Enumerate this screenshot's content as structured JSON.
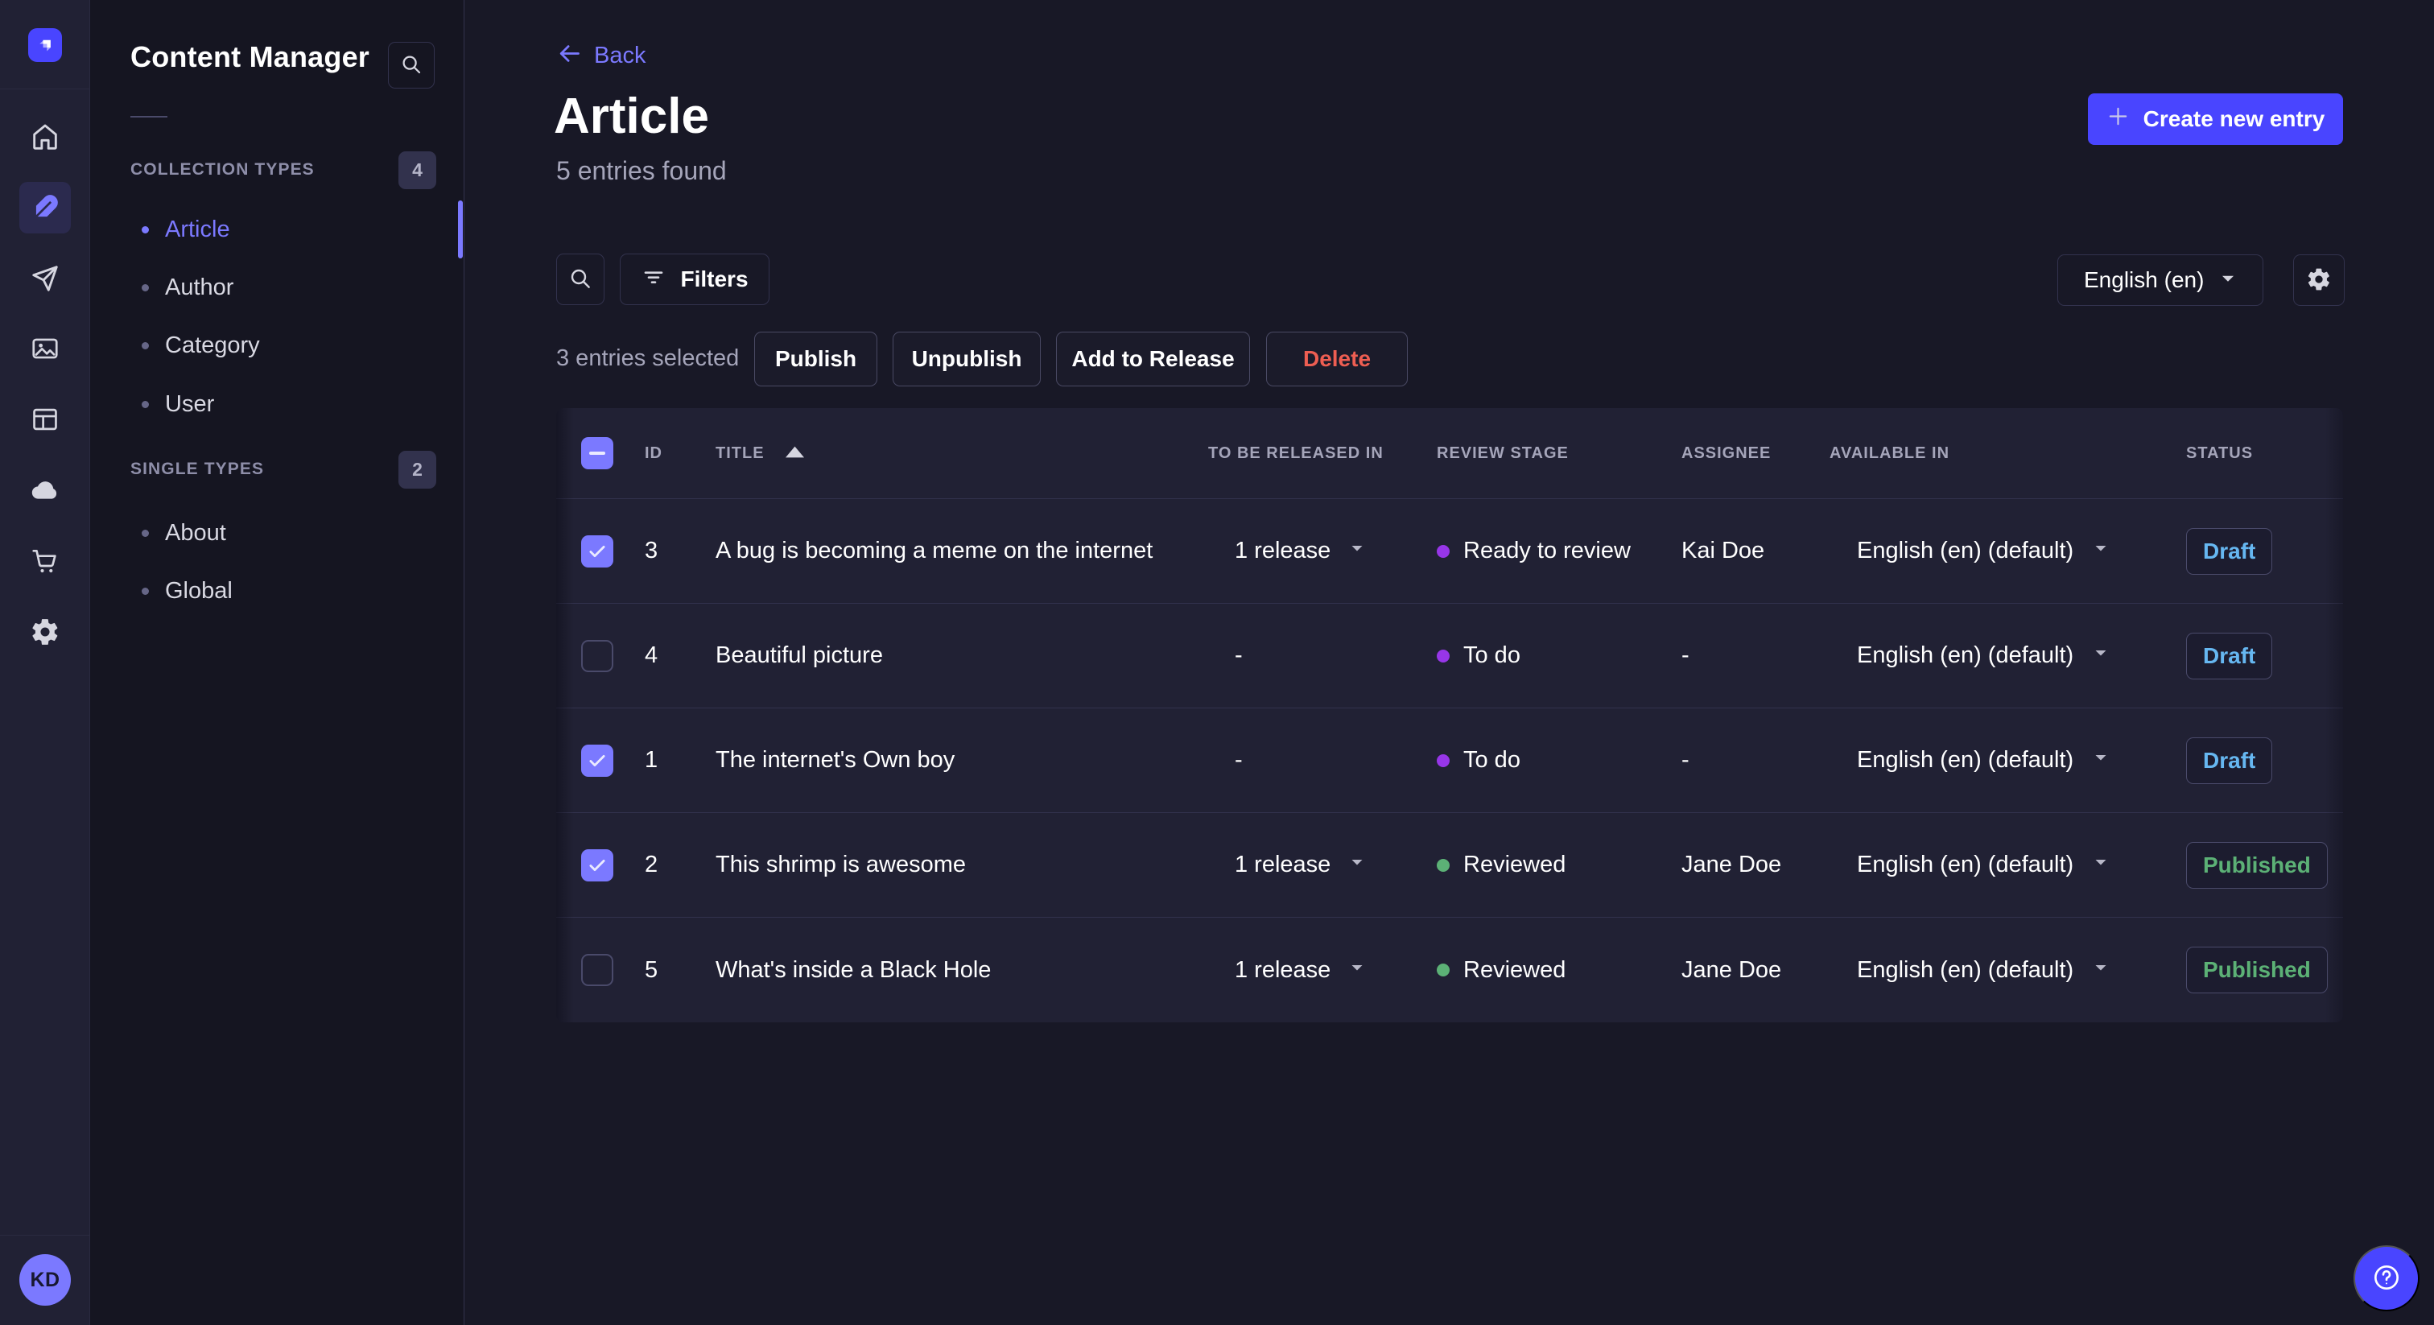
{
  "colors": {
    "accent_primary": "#4945ff",
    "accent_light": "#7b79ff",
    "page_bg": "#181826",
    "panel_bg": "#212134",
    "subnav_bg": "#151521",
    "danger": "#ee5e52",
    "success": "#5cb176",
    "draft_blue": "#66b7f1",
    "stage_purple": "#9736e8",
    "stage_green": "#5cb176"
  },
  "rail": {
    "logo_icon": "strapi-logo-icon",
    "items": [
      {
        "icon": "home-icon",
        "active": false
      },
      {
        "icon": "pen-icon",
        "active": true
      },
      {
        "icon": "paper-plane-icon",
        "active": false
      },
      {
        "icon": "images-icon",
        "active": false
      },
      {
        "icon": "layout-icon",
        "active": false
      },
      {
        "icon": "cloud-icon",
        "active": false
      },
      {
        "icon": "cart-icon",
        "active": false
      },
      {
        "icon": "gear-icon",
        "active": false
      }
    ],
    "avatar_initials": "KD"
  },
  "subnav": {
    "title": "Content Manager",
    "search_icon": "search-icon",
    "sections": [
      {
        "label": "COLLECTION TYPES",
        "badge": "4",
        "items": [
          {
            "label": "Article",
            "active": true
          },
          {
            "label": "Author",
            "active": false
          },
          {
            "label": "Category",
            "active": false
          },
          {
            "label": "User",
            "active": false
          }
        ]
      },
      {
        "label": "SINGLE TYPES",
        "badge": "2",
        "items": [
          {
            "label": "About",
            "active": false
          },
          {
            "label": "Global",
            "active": false
          }
        ]
      }
    ]
  },
  "header": {
    "back_label": "Back",
    "title": "Article",
    "subtitle": "5 entries found",
    "create_button": "Create new entry"
  },
  "toolbar": {
    "search_icon": "search-icon",
    "filters_label": "Filters",
    "locale_value": "English (en)",
    "settings_icon": "gear-icon"
  },
  "selection": {
    "summary": "3 entries selected",
    "publish_label": "Publish",
    "unpublish_label": "Unpublish",
    "add_to_release_label": "Add to Release",
    "delete_label": "Delete"
  },
  "table": {
    "columns": [
      "ID",
      "TITLE",
      "TO BE RELEASED IN",
      "REVIEW STAGE",
      "ASSIGNEE",
      "AVAILABLE IN",
      "STATUS"
    ],
    "sorted_column": "TITLE",
    "sort_direction": "ascending",
    "header_checkbox": "indeterminate",
    "rows": [
      {
        "checked": true,
        "id": "3",
        "title": "A bug is becoming a meme on the internet",
        "released": "1 release",
        "released_dropdown": true,
        "stage": "Ready to review",
        "stage_color": "#9736e8",
        "assignee": "Kai Doe",
        "locale": "English (en) (default)",
        "status": "Draft"
      },
      {
        "checked": false,
        "id": "4",
        "title": "Beautiful picture",
        "released": "-",
        "released_dropdown": false,
        "stage": "To do",
        "stage_color": "#9736e8",
        "assignee": "-",
        "locale": "English (en) (default)",
        "status": "Draft"
      },
      {
        "checked": true,
        "id": "1",
        "title": "The internet's Own boy",
        "released": "-",
        "released_dropdown": false,
        "stage": "To do",
        "stage_color": "#9736e8",
        "assignee": "-",
        "locale": "English (en) (default)",
        "status": "Draft"
      },
      {
        "checked": true,
        "id": "2",
        "title": "This shrimp is awesome",
        "released": "1 release",
        "released_dropdown": true,
        "stage": "Reviewed",
        "stage_color": "#5cb176",
        "assignee": "Jane Doe",
        "locale": "English (en) (default)",
        "status": "Published"
      },
      {
        "checked": false,
        "id": "5",
        "title": "What's inside a Black Hole",
        "released": "1 release",
        "released_dropdown": true,
        "stage": "Reviewed",
        "stage_color": "#5cb176",
        "assignee": "Jane Doe",
        "locale": "English (en) (default)",
        "status": "Published"
      }
    ]
  },
  "help": {
    "icon": "question-circle-icon"
  }
}
